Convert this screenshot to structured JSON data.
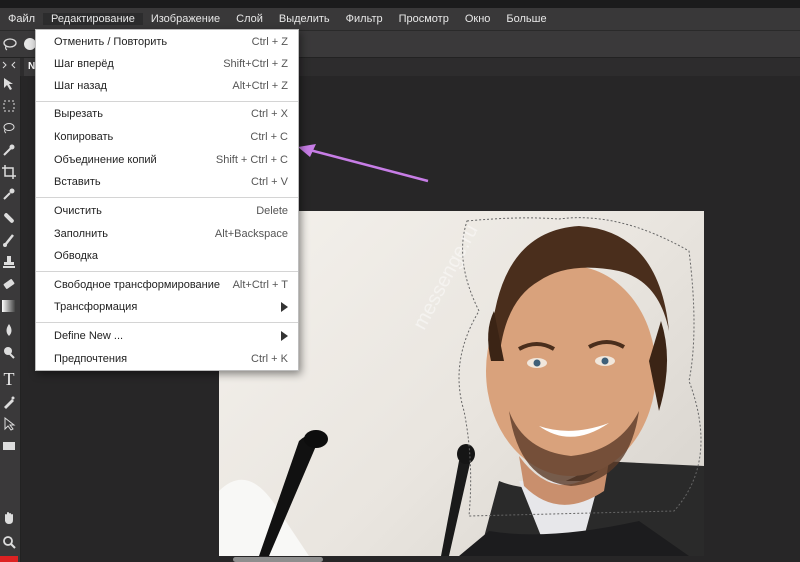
{
  "menubar": {
    "items": [
      "Файл",
      "Редактирование",
      "Изображение",
      "Слой",
      "Выделить",
      "Фильтр",
      "Просмотр",
      "Окно",
      "Больше"
    ]
  },
  "document": {
    "tab_label": "Ne"
  },
  "tools": {
    "icons": [
      "move-icon",
      "marquee-icon",
      "lasso-icon",
      "quick-select-icon",
      "crop-icon",
      "eyedropper-icon",
      "healing-icon",
      "brush-icon",
      "stamp-icon",
      "eraser-icon",
      "gradient-icon",
      "blur-icon",
      "dodge-icon",
      "type-icon",
      "pen-icon",
      "path-select-icon",
      "shape-icon",
      "hand-icon",
      "zoom-icon"
    ]
  },
  "edit_menu": {
    "items": [
      {
        "label": "Отменить / Повторить",
        "shortcut": "Ctrl + Z"
      },
      {
        "label": "Шаг вперёд",
        "shortcut": "Shift+Ctrl + Z"
      },
      {
        "label": "Шаг назад",
        "shortcut": "Alt+Ctrl + Z"
      },
      {
        "label": "Вырезать",
        "shortcut": "Ctrl + X"
      },
      {
        "label": "Копировать",
        "shortcut": "Ctrl + C"
      },
      {
        "label": "Объединение копий",
        "shortcut": "Shift + Ctrl + C"
      },
      {
        "label": "Вставить",
        "shortcut": "Ctrl + V"
      },
      {
        "label": "Очистить",
        "shortcut": "Delete"
      },
      {
        "label": "Заполнить",
        "shortcut": "Alt+Backspace"
      },
      {
        "label": "Обводка",
        "shortcut": ""
      },
      {
        "label": "Свободное трансформирование",
        "shortcut": "Alt+Ctrl + T"
      },
      {
        "label": "Трансформация",
        "shortcut": ""
      },
      {
        "label": "Define New ...",
        "shortcut": ""
      },
      {
        "label": "Предпочтения",
        "shortcut": "Ctrl + K"
      }
    ]
  },
  "colors": {
    "menu_bg": "#393839",
    "workspace_bg": "#272627",
    "annotation_arrow": "#c77de6"
  },
  "watermark": "messenge.ru"
}
